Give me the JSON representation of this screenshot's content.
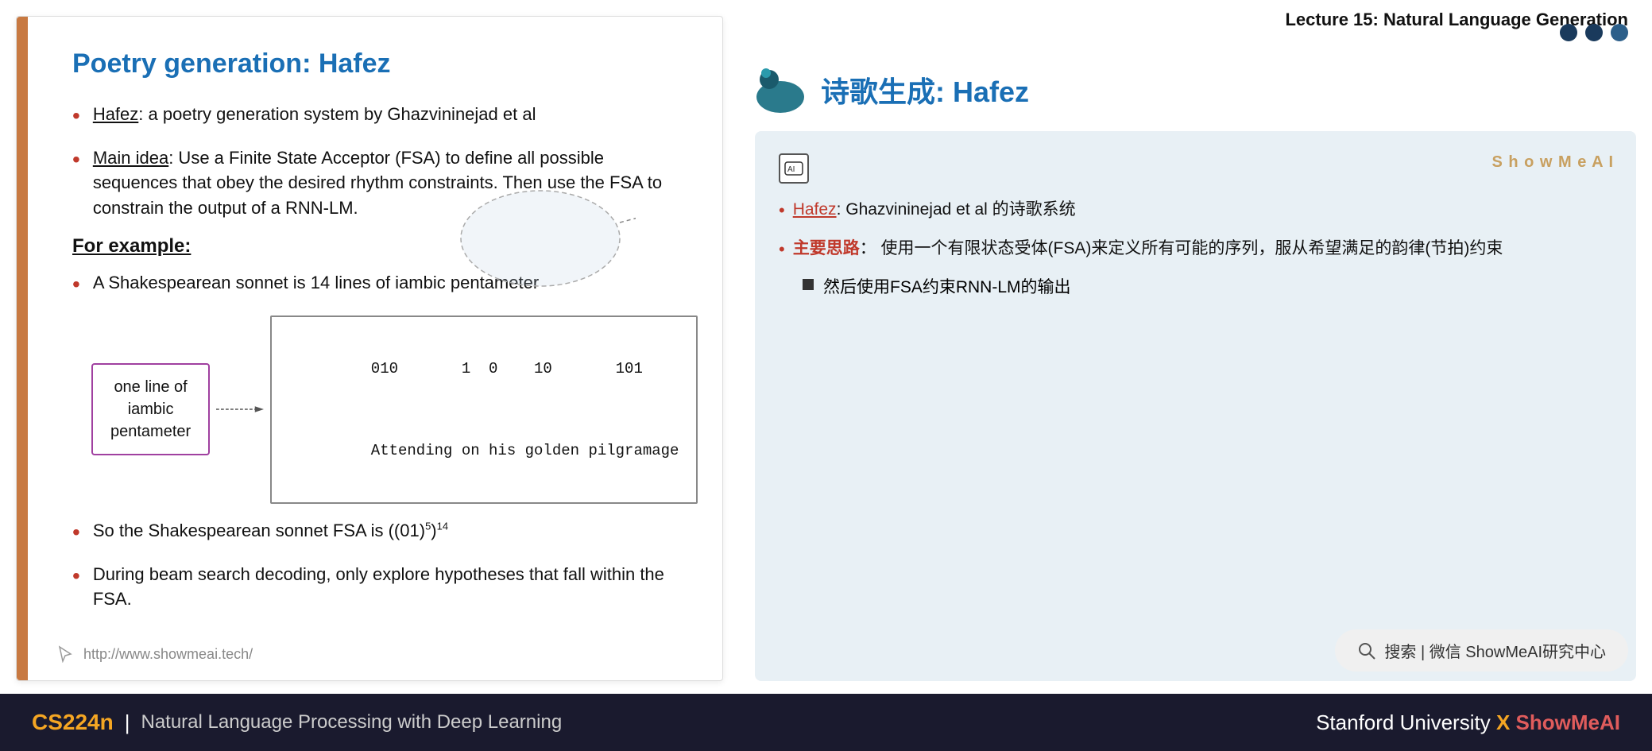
{
  "header": {
    "title": "Lecture 15: Natural Language Generation"
  },
  "left": {
    "slide_title": "Poetry generation: Hafez",
    "bullets": [
      {
        "prefix_underline": "Hafez",
        "text": ": a poetry generation system by Ghazvininejad et al"
      },
      {
        "prefix_underline": "Main idea",
        "text": ": Use a Finite State Acceptor (FSA) to define all possible sequences that obey the desired rhythm constraints. Then use the FSA to constrain the output of a RNN-LM."
      }
    ],
    "for_example_label": "For example:",
    "example_bullet": "A Shakespearean sonnet is 14 lines of iambic pentameter",
    "iambic_box_text": "one line of iambic pentameter",
    "code_line1": "   010       1  0    10       101",
    "code_line2": "   Attending on his golden pilgramage",
    "fsa_bullet_pre": "So the Shakespearean sonnet FSA is ((01)",
    "fsa_bullet_sup1": "5",
    "fsa_bullet_mid": ")",
    "fsa_bullet_sup2": "14",
    "beam_bullet": "During beam search decoding, only explore hypotheses that fall within the FSA.",
    "url": "http://www.showmeai.tech/"
  },
  "right": {
    "zh_title": "诗歌生成: Hafez",
    "showmeai_brand": "S h o w M e A I",
    "bullets": [
      {
        "prefix_underline": "Hafez",
        "text": ": Ghazvininejad et al 的诗歌系统"
      },
      {
        "prefix_key": "主要思路",
        "text": "： 使用一个有限状态受体(FSA)来定义所有可能的序列，服从希望满足的韵律(节拍)约束"
      }
    ],
    "sub_bullet": "然后使用FSA约束RNN-LM的输出"
  },
  "nav_dots": [
    {
      "active": true
    },
    {
      "active": true
    },
    {
      "active": false
    }
  ],
  "search_bar": {
    "text": "搜索 | 微信 ShowMeAI研究中心"
  },
  "footer": {
    "cs224n": "CS224n",
    "separator": "|",
    "nlp_text": "Natural Language Processing with Deep Learning",
    "right_text": "Stanford University",
    "x_mark": "X",
    "showmeai": "ShowMeAI"
  }
}
